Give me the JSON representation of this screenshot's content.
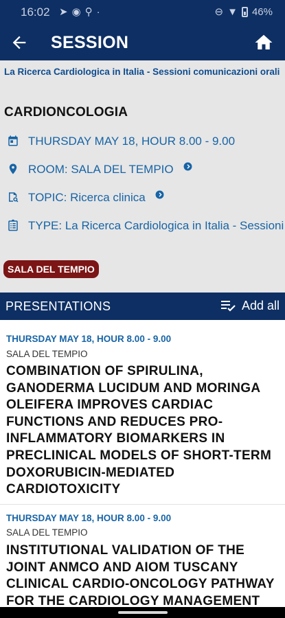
{
  "status_bar": {
    "time": "16:02",
    "left_icons": [
      "telegram-icon",
      "vpn-icon",
      "location-icon",
      "dot-icon"
    ],
    "battery": "46%"
  },
  "app_bar": {
    "title": "SESSION"
  },
  "session": {
    "congress": "La Ricerca Cardiologica in Italia - Sessioni comunicazioni orali",
    "title": "CARDIONCOLOGIA",
    "date": "THURSDAY MAY 18, HOUR 8.00 - 9.00",
    "room": "ROOM: SALA DEL TEMPIO",
    "topic": "TOPIC: Ricerca clinica",
    "type": "TYPE: La Ricerca Cardiologica in Italia - Sessioni comunicazioni orali",
    "room_badge": "SALA DEL TEMPIO",
    "room_badge_color": "#7c1515"
  },
  "presentations": {
    "label": "PRESENTATIONS",
    "add_all": "Add all",
    "items": [
      {
        "date": "THURSDAY MAY 18, HOUR 8.00 - 9.00",
        "room": "SALA DEL TEMPIO",
        "title": "COMBINATION OF SPIRULINA, GANODERMA LUCIDUM AND MORINGA OLEIFERA IMPROVES CARDIAC FUNCTIONS AND REDUCES PRO-INFLAMMATORY BIOMARKERS IN PRECLINICAL MODELS OF SHORT-TERM DOXORUBICIN-MEDIATED CARDIOTOXICITY"
      },
      {
        "date": "THURSDAY MAY 18, HOUR 8.00 - 9.00",
        "room": "SALA DEL TEMPIO",
        "title": "INSTITUTIONAL VALIDATION OF THE JOINT ANMCO AND AIOM TUSCANY CLINICAL CARDIO-ONCOLOGY PATHWAY FOR THE CARDIOLOGY MANAGEMENT"
      }
    ]
  },
  "colors": {
    "primary": "#0e2f63",
    "link": "#1764a6",
    "header_bg": "#e6e6e6"
  }
}
